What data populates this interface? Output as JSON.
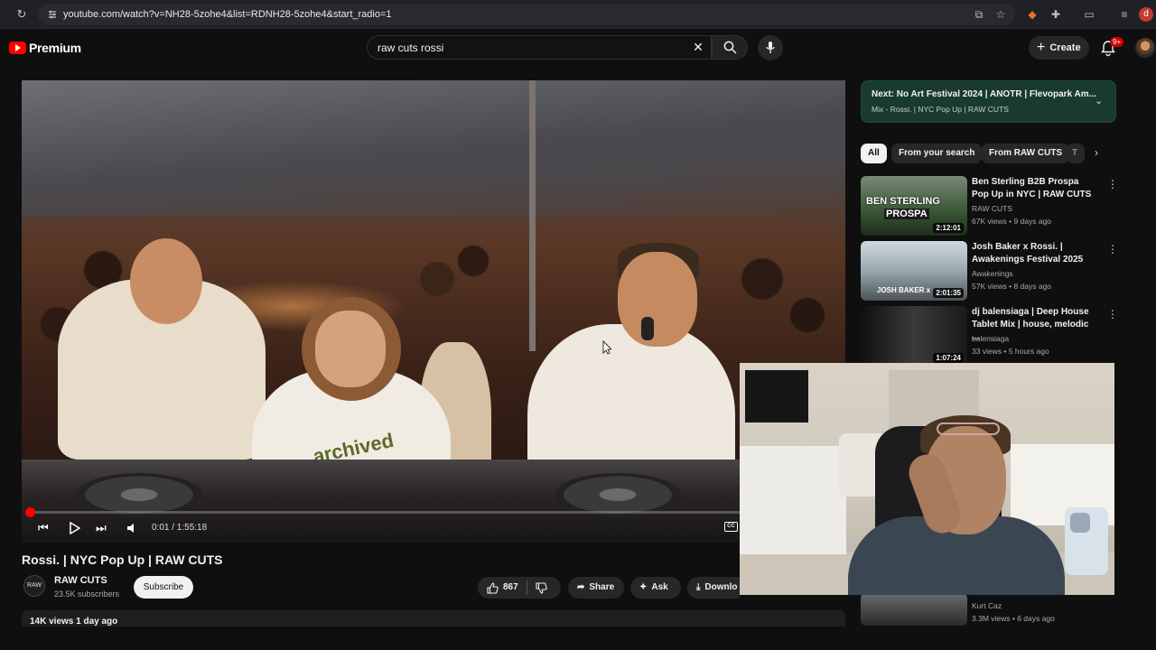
{
  "browser": {
    "url": "youtube.com/watch?v=NH28-5zohe4&list=RDNH28-5zohe4&start_radio=1",
    "profile_initial": "d"
  },
  "header": {
    "logo_text": "Premium",
    "search_query": "raw cuts rossi",
    "create_label": "Create",
    "notification_count": "9+"
  },
  "player": {
    "current_time": "0:01",
    "duration": "1:55:18",
    "time_display": "0:01 / 1:55:18",
    "progress_fraction": 0.0001,
    "cc_label": "CC",
    "overlay_text": "archived"
  },
  "video": {
    "title": "Rossi. | NYC Pop Up | RAW CUTS",
    "channel_name": "RAW CUTS",
    "subscribers": "23.5K subscribers",
    "subscribe_label": "Subscribe",
    "likes": "867",
    "share_label": "Share",
    "ask_label": "Ask",
    "download_label": "Downlo",
    "views_line": "14K views  1 day ago"
  },
  "sidebar": {
    "next_title": "Next: No Art Festival 2024 | ANOTR | Flevopark Am...",
    "next_subtitle": "Mix - Rossi. | NYC Pop Up | RAW CUTS",
    "chips": [
      "All",
      "From your search",
      "From RAW CUTS",
      "T"
    ],
    "recommendations": [
      {
        "title": "Ben Sterling B2B Prospa Pop Up in NYC | RAW CUTS",
        "channel": "RAW CUTS",
        "meta": "67K views • 9 days ago",
        "duration": "2:12:01",
        "thumb_text_1": "BEN STERLING",
        "thumb_text_2": "PROSPA"
      },
      {
        "title": "Josh Baker x Rossi. | Awakenings Festival 2025",
        "channel": "Awakenings",
        "meta": "57K views • 8 days ago",
        "duration": "2:01:35",
        "thumb_text_1": "JOSH BAKER x"
      },
      {
        "title": "dj balensiaga | Deep House Tablet Mix | house, melodic ...",
        "channel": "balensiaga",
        "meta": "33 views • 5 hours ago",
        "duration": "1:07:24"
      },
      {
        "channel": "Kurt Caz",
        "meta": "3.3M views • 6 days ago"
      }
    ]
  },
  "colors": {
    "brand_red": "#ff0000",
    "next_card_bg": "#183b2e",
    "page_bg": "#0f0f0f"
  }
}
